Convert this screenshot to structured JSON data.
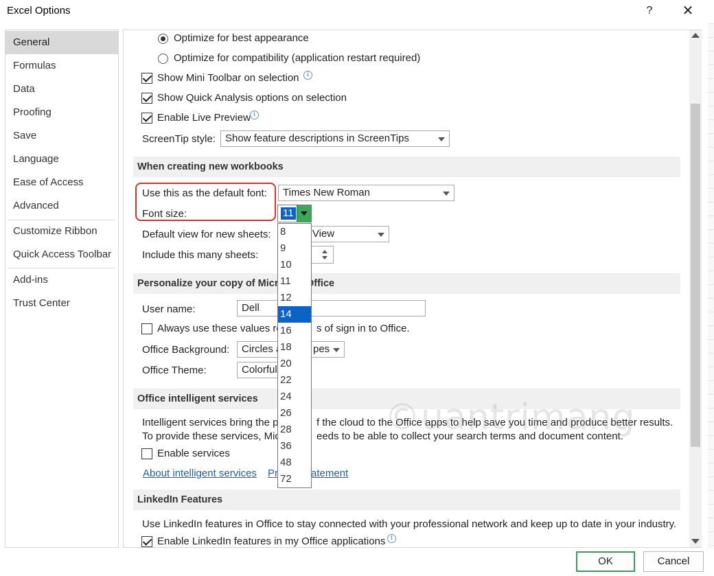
{
  "window": {
    "title": "Excel Options",
    "help_glyph": "?",
    "close_glyph": "✕"
  },
  "sidebar": {
    "items": [
      {
        "label": "General"
      },
      {
        "label": "Formulas"
      },
      {
        "label": "Data"
      },
      {
        "label": "Proofing"
      },
      {
        "label": "Save"
      },
      {
        "label": "Language"
      },
      {
        "label": "Ease of Access"
      },
      {
        "label": "Advanced"
      },
      {
        "label": "Customize Ribbon"
      },
      {
        "label": "Quick Access Toolbar"
      },
      {
        "label": "Add-ins"
      },
      {
        "label": "Trust Center"
      }
    ],
    "selected": "General"
  },
  "ui_options": {
    "radio_best_appearance": "Optimize for best appearance",
    "radio_compatibility": "Optimize for compatibility (application restart required)",
    "mini_toolbar": "Show Mini Toolbar on selection",
    "quick_analysis": "Show Quick Analysis options on selection",
    "live_preview": "Enable Live Preview",
    "screentip_label": "ScreenTip style:",
    "screentip_value": "Show feature descriptions in ScreenTips"
  },
  "new_workbooks": {
    "header": "When creating new workbooks",
    "default_font_label": "Use this as the default font:",
    "default_font_value": "Times New Roman",
    "font_size_label": "Font size:",
    "font_size_value": "11",
    "default_view_label": "Default view for new sheets:",
    "default_view_value": "al View",
    "sheets_label": "Include this many sheets:"
  },
  "font_size_dropdown": {
    "options": [
      "8",
      "9",
      "10",
      "11",
      "12",
      "14",
      "16",
      "18",
      "20",
      "22",
      "24",
      "26",
      "28",
      "36",
      "48",
      "72"
    ],
    "highlighted": "14"
  },
  "personalize": {
    "header": "Personalize your copy of Micr",
    "header_tail": "Office",
    "username_label": "User name:",
    "username_value": "Dell",
    "always_use_a": "Always use these values re",
    "always_use_b": "s of sign in to Office.",
    "background_label": "Office Background:",
    "background_value_a": "Circles a",
    "background_value_b": "pes",
    "theme_label": "Office Theme:",
    "theme_value": "Colorful"
  },
  "intelligent": {
    "header": "Office intelligent services",
    "desc1_a": "Intelligent services bring the p",
    "desc1_b": "f the cloud to the Office apps to help save you time and produce better results.",
    "desc2_a": "To provide these services, Mic",
    "desc2_b": "eeds to be able to collect your search terms and document content.",
    "enable": "Enable services",
    "about_link": "About intelligent services",
    "privacy_a": "Pri",
    "privacy_b": "atement"
  },
  "linkedin": {
    "header": "LinkedIn Features",
    "desc": "Use LinkedIn features in Office to stay connected with your professional network and keep up to date in your industry.",
    "enable": "Enable LinkedIn features in my Office applications"
  },
  "footer": {
    "ok": "OK",
    "cancel": "Cancel"
  },
  "watermark": "©uantrimang",
  "icons": {
    "info": "i"
  },
  "colors": {
    "accent": "#0a64c8",
    "highlight_border": "#d9302c",
    "dropdown_button": "#3aa85a",
    "ok_border": "#3c9a5a"
  }
}
